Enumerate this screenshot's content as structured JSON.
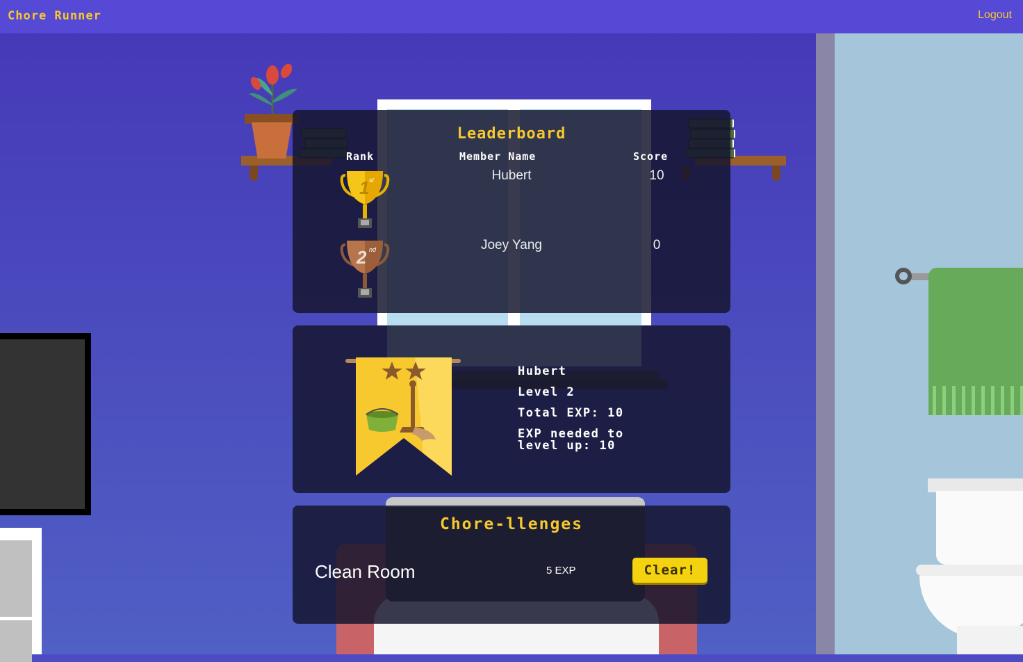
{
  "navbar": {
    "brand": "Chore Runner",
    "logout_label": "Logout"
  },
  "leaderboard": {
    "title": "Leaderboard",
    "headers": {
      "rank": "Rank",
      "member_name": "Member Name",
      "score": "Score"
    },
    "rows": [
      {
        "rank": "1",
        "rank_suffix": "st",
        "name": "Hubert",
        "score": "10",
        "trophy": "gold-trophy-icon"
      },
      {
        "rank": "2",
        "rank_suffix": "nd",
        "name": "Joey Yang",
        "score": "0",
        "trophy": "bronze-trophy-icon"
      }
    ]
  },
  "profile": {
    "name": "Hubert",
    "level": "Level 2",
    "total_exp": "Total EXP: 10",
    "exp_needed_line1": "EXP needed to",
    "exp_needed_line2": "level up: 10",
    "stars": 2,
    "badge_icon": "cleaning-banner-icon"
  },
  "challenges": {
    "title": "Chore-llenges",
    "items": [
      {
        "name": "Clean Room",
        "exp": "5 EXP",
        "button_label": "Clear!"
      }
    ]
  },
  "colors": {
    "accent": "#f7c92e",
    "navbar": "#5549d6",
    "panel": "#14142d",
    "button": "#f5d20f"
  }
}
